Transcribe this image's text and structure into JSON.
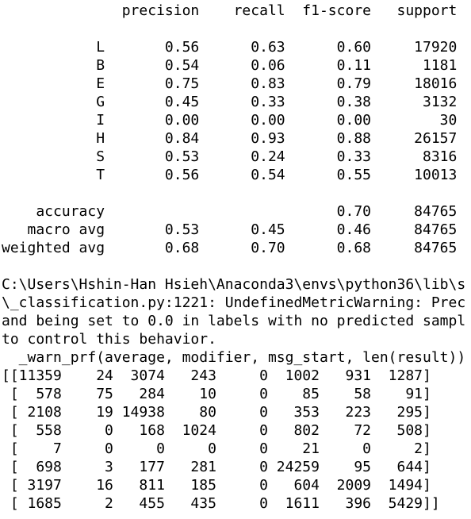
{
  "console": {
    "report_header": "              precision    recall  f1-score   support",
    "report_rows": [
      "           L       0.56      0.63      0.60     17920",
      "           B       0.54      0.06      0.11      1181",
      "           E       0.75      0.83      0.79     18016",
      "           G       0.45      0.33      0.38      3132",
      "           I       0.00      0.00      0.00        30",
      "           H       0.84      0.93      0.88     26157",
      "           S       0.53      0.24      0.33      8316",
      "           T       0.56      0.54      0.55     10013"
    ],
    "summary_rows": [
      "    accuracy                           0.70     84765",
      "   macro avg       0.53      0.45      0.46     84765",
      "weighted avg       0.68      0.70      0.68     84765"
    ],
    "warning_lines": [
      "C:\\Users\\Hshin-Han Hsieh\\Anaconda3\\envs\\python36\\lib\\s",
      "\\_classification.py:1221: UndefinedMetricWarning: Prec",
      "and being set to 0.0 in labels with no predicted sampl",
      "to control this behavior.",
      "  _warn_prf(average, modifier, msg_start, len(result))"
    ],
    "matrix_rows": [
      "[[11359    24  3074   243     0  1002   931  1287]",
      " [  578    75   284    10     0    85    58    91]",
      " [ 2108    19 14938    80     0   353   223   295]",
      " [  558     0   168  1024     0   802    72   508]",
      " [    7     0     0     0     0    21     0     2]",
      " [  698     3   177   281     0 24259    95   644]",
      " [ 3197    16   811   185     0   604  2009  1494]",
      " [ 1685     2   455   435     0  1611   396  5429]]"
    ]
  }
}
